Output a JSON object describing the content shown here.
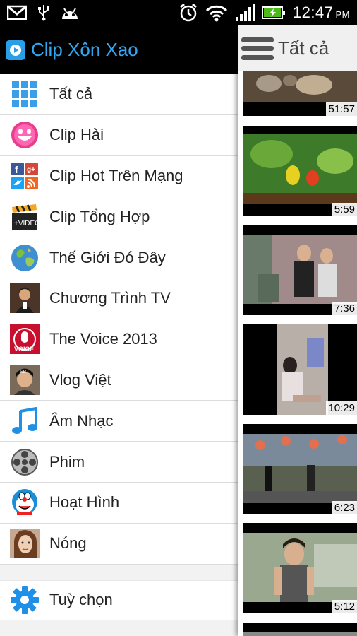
{
  "status_bar": {
    "time": "12:47",
    "ampm": "PM",
    "icons": [
      "gmail-icon",
      "usb-icon",
      "android-icon",
      "alarm-icon",
      "wifi-icon",
      "signal-icon",
      "battery-charging-icon"
    ]
  },
  "app": {
    "title": "Clip Xôn Xao"
  },
  "menu": {
    "items": [
      {
        "label": "Tất cả",
        "icon": "grid-icon"
      },
      {
        "label": "Clip Hài",
        "icon": "smiley-icon"
      },
      {
        "label": "Clip Hot Trên Mạng",
        "icon": "social-icon"
      },
      {
        "label": "Clip Tổng Hợp",
        "icon": "clapperboard-icon"
      },
      {
        "label": "Thế Giới Đó Đây",
        "icon": "globe-icon"
      },
      {
        "label": "Chương Trình TV",
        "icon": "tv-host-icon"
      },
      {
        "label": "The Voice 2013",
        "icon": "the-voice-icon"
      },
      {
        "label": "Vlog Việt",
        "icon": "vlogger-icon"
      },
      {
        "label": "Âm Nhạc",
        "icon": "music-note-icon"
      },
      {
        "label": "Phim",
        "icon": "film-reel-icon"
      },
      {
        "label": "Hoạt Hình",
        "icon": "doraemon-icon"
      },
      {
        "label": "Nóng",
        "icon": "portrait-icon"
      }
    ],
    "settings_label": "Tuỳ chọn",
    "settings_icon": "gear-icon"
  },
  "content": {
    "title": "Tất cả",
    "videos": [
      {
        "duration": "51:57"
      },
      {
        "duration": "5:59"
      },
      {
        "duration": "7:36"
      },
      {
        "duration": "10:29"
      },
      {
        "duration": "6:23"
      },
      {
        "duration": "5:12"
      },
      {
        "duration": ""
      }
    ]
  },
  "colors": {
    "accent": "#33a6f0",
    "drawer_bg": "#ffffff",
    "header_bg": "#000000"
  }
}
